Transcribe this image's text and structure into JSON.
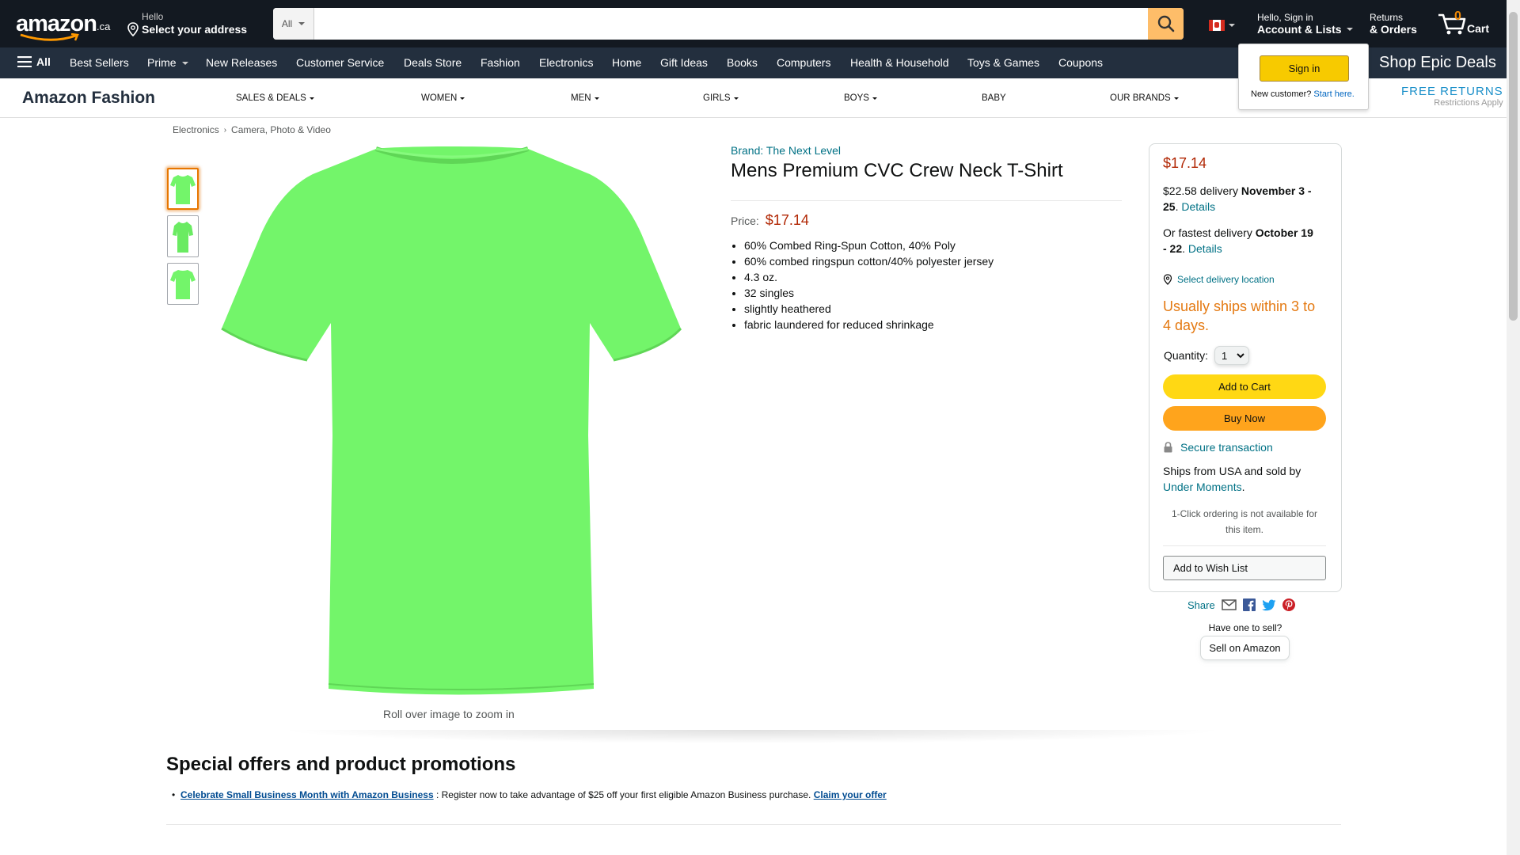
{
  "header": {
    "logo_text": "amazon",
    "logo_tld": ".ca",
    "address_greeting": "Hello",
    "address_action": "Select your address",
    "search_category": "All",
    "search_placeholder": "",
    "account_greeting": "Hello, Sign in",
    "account_label": "Account & Lists",
    "returns_small": "Returns",
    "returns_big": "& Orders",
    "cart_count": "0",
    "cart_label": "Cart"
  },
  "signin_flyout": {
    "button": "Sign in",
    "new_customer": "New customer?",
    "start_here": "Start here."
  },
  "nav": {
    "all_label": "All",
    "items": [
      "Best Sellers",
      "Prime",
      "New Releases",
      "Customer Service",
      "Deals Store",
      "Fashion",
      "Electronics",
      "Home",
      "Gift Ideas",
      "Books",
      "Computers",
      "Health & Household",
      "Toys & Games",
      "Coupons"
    ],
    "promo": "Shop Epic Deals"
  },
  "fashion_nav": {
    "brand": "Amazon Fashion",
    "links": [
      "SALES & DEALS",
      "WOMEN",
      "MEN",
      "GIRLS",
      "BOYS",
      "BABY",
      "OUR BRANDS"
    ],
    "free_returns": "FREE RETURNS",
    "restrictions": "Restrictions Apply"
  },
  "breadcrumb": [
    "Electronics",
    "Camera, Photo & Video"
  ],
  "product": {
    "brand": "Brand: The Next Level",
    "title": "Mens Premium CVC Crew Neck T-Shirt",
    "price_label": "Price:",
    "price": "$17.14",
    "bullets": [
      "60% Combed Ring-Spun Cotton, 40% Poly",
      "60% combed ringspun cotton/40% polyester jersey",
      "4.3 oz.",
      "32 singles",
      "slightly heathered",
      "fabric laundered for reduced shrinkage"
    ],
    "zoom_hint": "Roll over image to zoom in",
    "image_color": "#73f56a"
  },
  "buybox": {
    "price": "$17.14",
    "delivery_prefix": "$22.58 delivery",
    "delivery_dates": "November 3 - 25",
    "details": "Details",
    "fastest_prefix": "Or fastest delivery",
    "fastest_dates": "October 19 - 22",
    "select_location": "Select delivery location",
    "ships_within": "Usually ships within 3 to 4 days.",
    "quantity_label": "Quantity:",
    "quantity_value": "1",
    "add_to_cart": "Add to Cart",
    "buy_now": "Buy Now",
    "secure": "Secure transaction",
    "ships_from": "Ships from USA and sold by",
    "seller": "Under Moments",
    "one_click": "1-Click ordering is not available for this item.",
    "wish_list": "Add to Wish List"
  },
  "share": {
    "label": "Share",
    "icons": [
      "email-icon",
      "facebook-icon",
      "twitter-icon",
      "pinterest-icon"
    ],
    "have_one": "Have one to sell?",
    "sell_button": "Sell on Amazon"
  },
  "offers": {
    "heading": "Special offers and product promotions",
    "link": "Celebrate Small Business Month with Amazon Business",
    "text": " : Register now to take advantage of $25 off your first eligible Amazon Business purchase. ",
    "claim": "Claim your offer"
  },
  "colors": {
    "nav_dark": "#131921",
    "nav_secondary": "#232f3e",
    "price_red": "#b12704",
    "link_teal": "#007185",
    "add_to_cart_yellow": "#ffd814",
    "buy_now_orange": "#ffa41c",
    "ships_orange": "#e47911"
  }
}
